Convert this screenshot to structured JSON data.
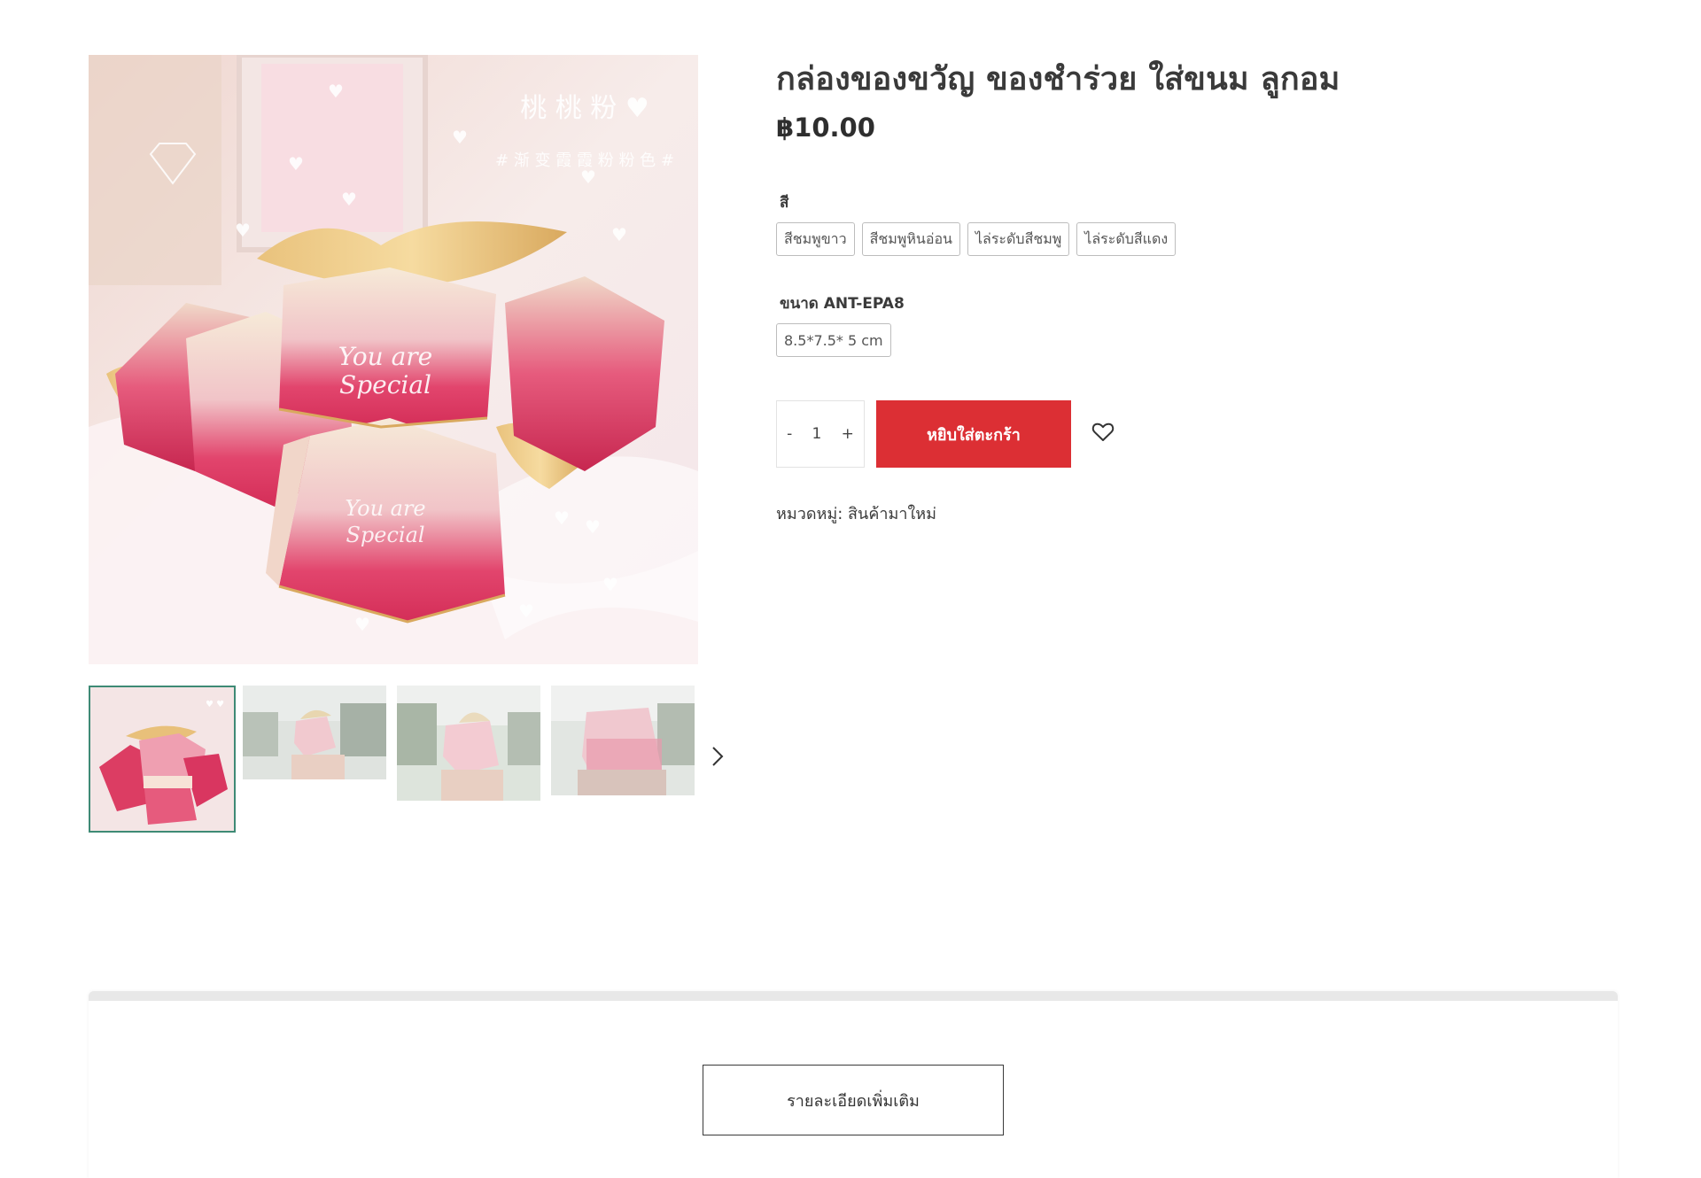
{
  "product": {
    "title": "กล่องของขวัญ ของชำร่วย ใส่ขนม ลูกอม",
    "price": "฿10.00",
    "color_label": "สี",
    "colors": [
      "สีชมพูขาว",
      "สีชมพูหินอ่อน",
      "ไล่ระดับสีชมพู",
      "ไล่ระดับสีแดง"
    ],
    "size_label": "ขนาด ANT-EPA8",
    "sizes": [
      "8.5*7.5* 5 cm"
    ],
    "quantity": "1",
    "qty_minus": "-",
    "qty_plus": "+",
    "add_to_cart": "หยิบใส่ตะกร้า",
    "category": "หมวดหมู่: สินค้ามาใหม่"
  },
  "gallery": {
    "main_image_text": {
      "chinese_top": "桃 桃 粉",
      "chinese_sub": "# 渐 变 霞 霞 粉 粉 色 #",
      "script": "You are Special"
    },
    "thumbnail_count": 4,
    "next_icon": "chevron-right-icon"
  },
  "details": {
    "more_button": "รายละเอียดเพิ่มเติม"
  },
  "icons": {
    "wishlist": "heart-outline-icon"
  },
  "colors": {
    "accent": "#dc2f34",
    "active_thumb_border": "#3e8a75",
    "box_pink": "#e03a62",
    "ribbon_gold": "#e8c07a"
  }
}
